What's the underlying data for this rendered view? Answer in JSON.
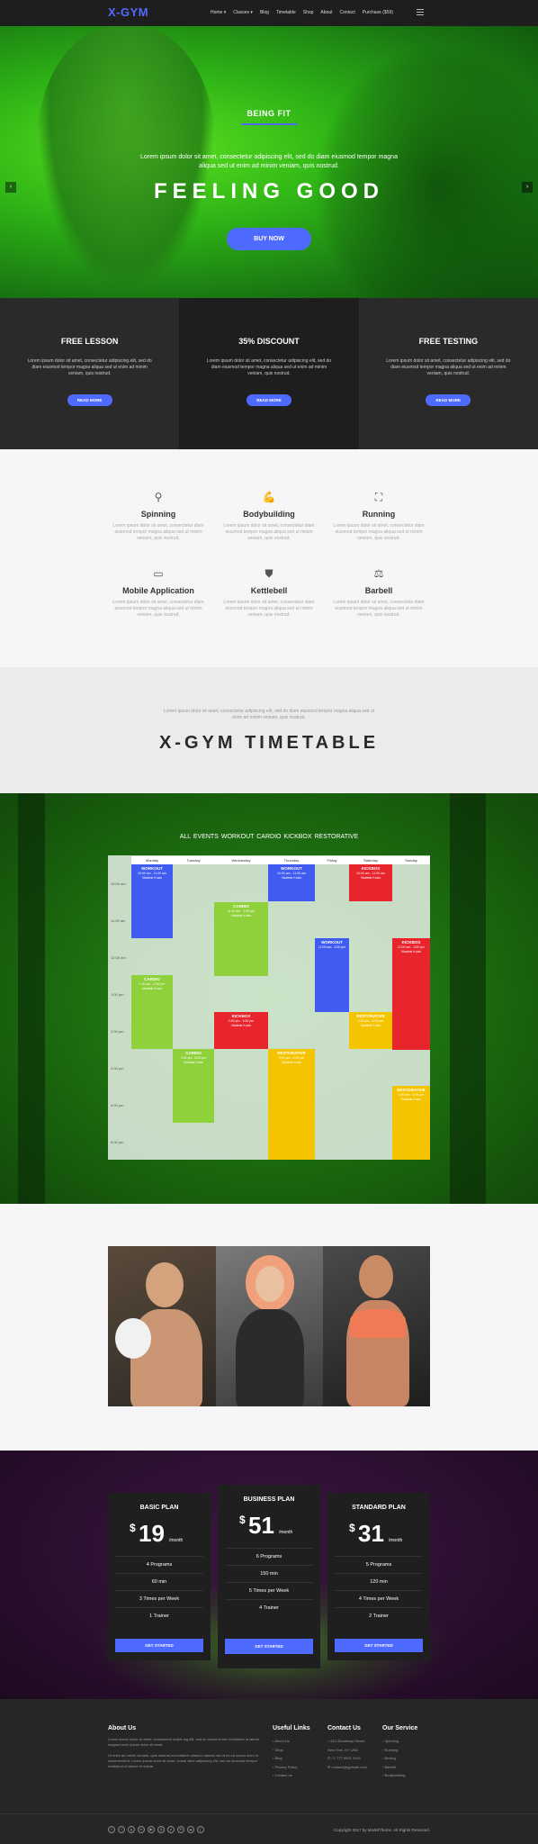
{
  "nav": {
    "logo": "X-GYM",
    "items": [
      "Home ▾",
      "Classes ▾",
      "Blog",
      "Timetable",
      "Shop",
      "About",
      "Contact",
      "Purchase ($59)"
    ]
  },
  "hero": {
    "kicker": "BEING FIT",
    "subtitle": "Lorem ipsum dolor sit amet, consectetur adipiscing elit, sed do diam eiusmod tempor magna aliqua sed ut enim ad minim veniam, quis nostrud.",
    "title": "FEELING GOOD",
    "button": "BUY NOW"
  },
  "promos": [
    {
      "title": "FREE LESSON",
      "text": "Lorem ipsum dolor sit amet, consectetur adipiscing elit, sed do diam eiusmod tempor magna aliqua sed ut enim ad minim veniam, quis nostrud.",
      "button": "READ MORE",
      "bg": "#2a2a2a"
    },
    {
      "title": "35% DISCOUNT",
      "text": "Lorem ipsum dolor sit amet, consectetur adipiscing elit, sed do diam eiusmod tempor magna aliqua sed ut enim ad minim veniam, quis nostrud.",
      "button": "READ MORE",
      "bg": "#1e1e1e"
    },
    {
      "title": "FREE TESTING",
      "text": "Lorem ipsum dolor sit amet, consectetur adipiscing elit, sed do diam eiusmod tempor magna aliqua sed ut enim ad minim veniam, quis nostrud.",
      "button": "READ MORE",
      "bg": "#2a2a2a"
    }
  ],
  "services": [
    {
      "title": "Spinning",
      "icon": "bike-icon",
      "glyph": "⚲",
      "text": "Lorem ipsum dolor sit amet, consectetur diam eiusmod tempor magna aliqua sed ut minim veniam, quis nostrud."
    },
    {
      "title": "Bodybuilding",
      "icon": "muscle-icon",
      "glyph": "💪",
      "text": "Lorem ipsum dolor sit amet, consectetur diam eiusmod tempor magna aliqua sed ut minim veniam, quis nostrud."
    },
    {
      "title": "Running",
      "icon": "treadmill-icon",
      "glyph": "⛶",
      "text": "Lorem ipsum dolor sit amet, consectetur diam eiusmod tempor magna aliqua sed ut minim veniam, quis nostrud."
    },
    {
      "title": "Mobile Application",
      "icon": "battery-icon",
      "glyph": "▭",
      "text": "Lorem ipsum dolor sit amet, consectetur diam eiusmod tempor magna aliqua sed ut minim veniam, quis nostrud."
    },
    {
      "title": "Kettlebell",
      "icon": "kettlebell-icon",
      "glyph": "⛊",
      "text": "Lorem ipsum dolor sit amet, consectetur diam eiusmod tempor magna aliqua sed ut minim veniam, quis nostrud."
    },
    {
      "title": "Barbell",
      "icon": "barbell-icon",
      "glyph": "⚖",
      "text": "Lorem ipsum dolor sit amet, consectetur diam eiusmod tempor magna aliqua sed ut minim veniam, quis nostrud."
    }
  ],
  "timetable": {
    "intro": "Lorem ipsum dolor sit amet, consectetur adipiscing elit, sed do diam eiusmod tempor magna aliqua sed ut enim ad minim veniam, quis nostrud.",
    "title": "X-GYM TIMETABLE",
    "filters": [
      "ALL EVENTS",
      "WORKOUT",
      "CARDIO",
      "KICKBOX",
      "RESTORATIVE"
    ],
    "days": [
      "Monday",
      "Tuesday",
      "Wednesday",
      "Thursday",
      "Friday",
      "Saturday",
      "Sunday"
    ],
    "times": [
      "10:00 am",
      "11:00 am",
      "12:00 am",
      "1:00 pm",
      "2:00 pm",
      "3:00 pm",
      "4:00 pm",
      "5:00 pm"
    ],
    "events": [
      {
        "name": "WORKOUT",
        "time": "10:00 am - 11:00 am",
        "trainer": "Vladimir Kozlo",
        "color": "#3f5bf0"
      },
      {
        "name": "CARDIO",
        "time": "11:00 am - 1:00 pm",
        "trainer": "Vladimir Kozlo",
        "color": "#8fd13a"
      },
      {
        "name": "WORKOUT",
        "time": "10:00 am - 11:00 am",
        "trainer": "Vladimir Kozlo",
        "color": "#3f5bf0"
      },
      {
        "name": "KICKBOX",
        "time": "10:00 am - 11:00 am",
        "trainer": "Vladimir Kozlo",
        "color": "#e8242c"
      },
      {
        "name": "WORKOUT",
        "time": "12:00 am - 2:00 pm",
        "trainer": "",
        "color": "#3f5bf0"
      },
      {
        "name": "KICKBOX",
        "time": "12:00 am - 3:00 pm",
        "trainer": "Vladimir Kozlo",
        "color": "#e8242c"
      },
      {
        "name": "CARDIO",
        "time": "1:00 pm - 2:00 pm",
        "trainer": "Vladimir Kozlo",
        "color": "#8fd13a"
      },
      {
        "name": "KICKBOX",
        "time": "2:00 pm - 3:00 pm",
        "trainer": "Vladimir Kozlo",
        "color": "#e8242c"
      },
      {
        "name": "RESTORATIVE",
        "time": "2:00 pm - 3:00 pm",
        "trainer": "Vladimir Kozlo",
        "color": "#f5c400"
      },
      {
        "name": "CARDIO",
        "time": "3:00 pm - 5:00 pm",
        "trainer": "Vladimir Kozlo",
        "color": "#8fd13a"
      },
      {
        "name": "RESTORATIVE",
        "time": "3:00 pm - 6:00 pm",
        "trainer": "Vladimir Kozlo",
        "color": "#f5c400"
      },
      {
        "name": "RESTORATIVE",
        "time": "4:00 pm - 6:00 pm",
        "trainer": "Vladimir Kozlo",
        "color": "#f5c400"
      }
    ]
  },
  "pricing": [
    {
      "name": "BASIC PLAN",
      "currency": "$",
      "price": "19",
      "period": "/month",
      "features": [
        "4 Programs",
        "60 min",
        "3 Times per Week",
        "1 Trainer"
      ],
      "button": "GET STARTED"
    },
    {
      "name": "BUSINESS PLAN",
      "currency": "$",
      "price": "51",
      "period": "/month",
      "features": [
        "6 Programs",
        "150 min",
        "5 Times per Week",
        "4 Trainer"
      ],
      "button": "GET STARTED"
    },
    {
      "name": "STANDARD PLAN",
      "currency": "$",
      "price": "31",
      "period": "/month",
      "features": [
        "5 Programs",
        "120 min",
        "4 Times per Week",
        "2 Trainer"
      ],
      "button": "GET STARTED"
    }
  ],
  "footer": {
    "about_title": "About Us",
    "about_text1": "Lorem ipsum dolor sit amet, consectetur adipis ing elit, sed do eiusmod tem incididunt ut labore magna lorem ipsum dolor sit amet.",
    "about_text2": "Ut enim ad minim veniam, quis nostrud exercitation ullamco laboris nisi ut ex ea comm dolor in reprehenderit. Lorem ipsum dolor sit amet, conse ollee adipiscing elit, sed do eiusmod tempor incididunt ut labore et dolore.",
    "links_title": "Useful Links",
    "links": [
      "› About Us",
      "› Shop",
      "› Blog",
      "› Privacy Policy",
      "› Contact us"
    ],
    "contact_title": "Contact Us",
    "contact": [
      "⌂ 621 Broadway Street,",
      "New York, NY USA",
      "✆ +1 777 9991 2002",
      "✉ contact@gymsite.com"
    ],
    "service_title": "Our Service",
    "service_items": [
      "› Spinning",
      "› Running",
      "› Boxing",
      "› Barbell",
      "› Bodybuilding"
    ],
    "copyright": "Copyright 2017 by ModelTheme. All Rights Reserved.",
    "socials": [
      "f",
      "t",
      "g",
      "in",
      "▶",
      "◎",
      "p",
      "✉",
      "☁",
      "ƒ"
    ]
  }
}
